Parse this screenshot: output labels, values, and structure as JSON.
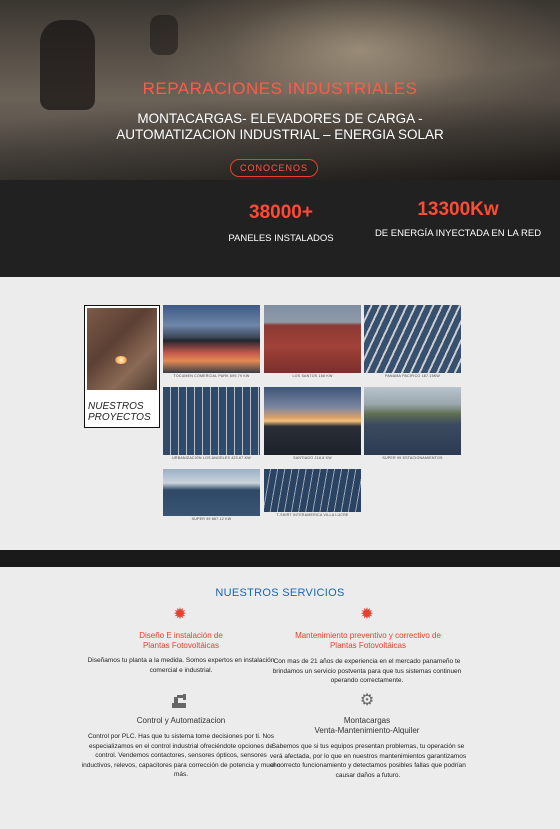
{
  "hero": {
    "title": "REPARACIONES INDUSTRIALES",
    "subtitle_line1": "MONTACARGAS- ELEVADORES DE CARGA -",
    "subtitle_line2": "AUTOMATIZACION INDUSTRIAL – ENERGIA SOLAR",
    "button_label": "CONOCENOS"
  },
  "stats": [
    {
      "value": "38000+",
      "label": "PANELES INSTALADOS"
    },
    {
      "value": "13300Kw",
      "label": "DE ENERGÍA INYECTADA EN LA RED"
    }
  ],
  "projects": {
    "card_label_line1": "NUESTROS",
    "card_label_line2": "PROYECTOS",
    "thumbs": [
      {
        "caption": "TOCUMEN COMERCIAL PARK 699.79 KW"
      },
      {
        "caption": "LOS SANTOS 156 KW"
      },
      {
        "caption": "PANAMA PACIFICO 187.15KW"
      },
      {
        "caption": "URBANIZACIÓN LOS ANGELES 423.67 KW"
      },
      {
        "caption": "SANTIAGO 218.8 KW"
      },
      {
        "caption": "SUPER 99 ESTACIONAMIENTOS"
      },
      {
        "caption": "SUPER 99 867.12 KW"
      },
      {
        "caption": "T-SHIRT INTERAMERICA VILLA LUCRE"
      }
    ]
  },
  "services": {
    "title": "NUESTROS SERVICIOS",
    "items": [
      {
        "icon": "gear-icon",
        "title_line1": "Diseño E instalación de",
        "title_line2": "Plantas Fotovoltáicas",
        "body": "Diseñamos tu planta a la medida. Somos expertos en instalación comercial e industrial."
      },
      {
        "icon": "gear-icon",
        "title_line1": "Mantenimiento preventivo y correctivo de",
        "title_line2": "Plantas Fotovoltáicas",
        "body": "Con mas de 21 años de experiencia en el mercado panameño te brindamos un servicio postventa para que tus sistemas continuen operando correctamente."
      },
      {
        "icon": "robot-arm-icon",
        "title_line1": "Control y Automatizacion",
        "title_line2": "",
        "body": "Control por PLC. Has que tu sistema tome decisiones por ti. Nos especializamos en el control industrial ofreciéndote opciones de control. Vendemos contactores, sensores ópticos, sensores inductivos, relevos, capacitores para corrección de potencia y mucho más."
      },
      {
        "icon": "cog-icon",
        "title_line1": "Montacargas",
        "title_line2": "Venta-Mantenimiento-Alquiler",
        "body": "Sabemos que si tus equipos presentan problemas, tu operación se verá afectada, por lo que en nuestros mantenimientos garantizamos el correcto funcionamiento y detectamos posibles fallas que podrían causar daños a futuro."
      }
    ]
  },
  "colors": {
    "accent": "#ff4a35",
    "services_title": "#1a66b3",
    "dark_band": "#212121"
  }
}
